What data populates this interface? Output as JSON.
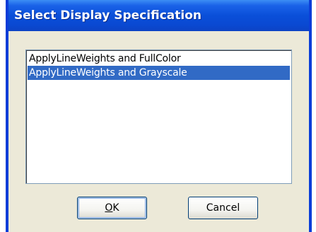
{
  "window": {
    "title": "Select Display Specification"
  },
  "list": {
    "items": [
      "ApplyLineWeights and FullColor",
      "ApplyLineWeights and Grayscale"
    ],
    "selected_index": 1
  },
  "buttons": {
    "ok_label": "OK",
    "cancel_label": "Cancel"
  },
  "colors": {
    "titlebar": "#0a4fd9",
    "selection": "#316ac5",
    "dialog_bg": "#ece9d8"
  }
}
